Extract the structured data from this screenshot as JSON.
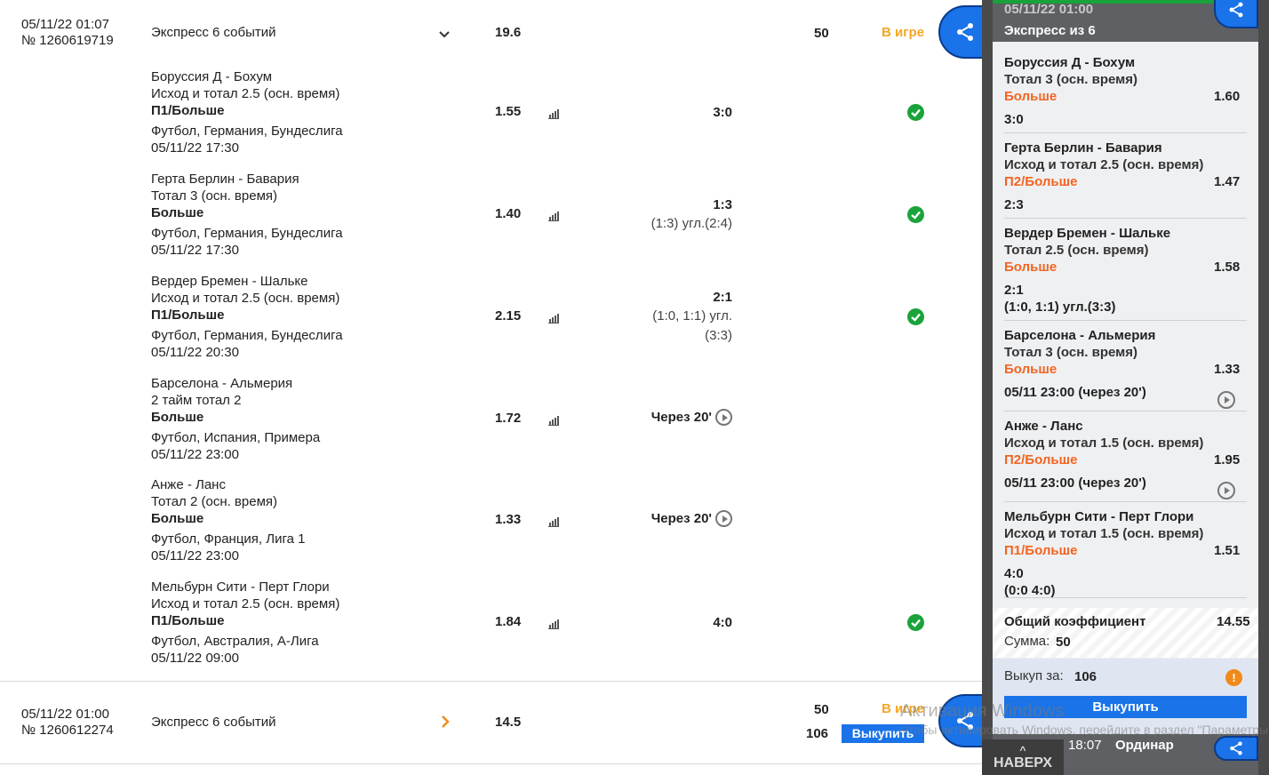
{
  "main": {
    "bet1": {
      "date": "05/11/22 01:07",
      "number": "№ 1260619719",
      "title": "Экспресс 6 событий",
      "odds": "19.6",
      "stake": "50",
      "status": "В игре",
      "events": [
        {
          "match": "Боруссия Д - Бохум",
          "market": "Исход и тотал 2.5 (осн. время)",
          "pick": "П1/Больше",
          "league": "Футбол, Германия, Бундеслига",
          "time": "05/11/22 17:30",
          "odds": "1.55",
          "score": "3:0",
          "score_sub": [],
          "state": "won"
        },
        {
          "match": "Герта Берлин - Бавария",
          "market": "Тотал 3 (осн. время)",
          "pick": "Больше",
          "league": "Футбол, Германия, Бундеслига",
          "time": "05/11/22 17:30",
          "odds": "1.40",
          "score": "1:3",
          "score_sub": [
            "(1:3) угл.(2:4)"
          ],
          "state": "won"
        },
        {
          "match": "Вердер Бремен - Шальке",
          "market": "Исход и тотал 2.5 (осн. время)",
          "pick": "П1/Больше",
          "league": "Футбол, Германия, Бундеслига",
          "time": "05/11/22 20:30",
          "odds": "2.15",
          "score": "2:1",
          "score_sub": [
            "(1:0, 1:1) угл.",
            "(3:3)"
          ],
          "state": "won"
        },
        {
          "match": "Барселона - Альмерия",
          "market": "2 тайм тотал 2",
          "pick": "Больше",
          "league": "Футбол, Испания, Примера",
          "time": "05/11/22 23:00",
          "odds": "1.72",
          "score": "Через 20'",
          "score_sub": [],
          "state": "pending"
        },
        {
          "match": "Анже - Ланс",
          "market": "Тотал 2 (осн. время)",
          "pick": "Больше",
          "league": "Футбол, Франция, Лига 1",
          "time": "05/11/22 23:00",
          "odds": "1.33",
          "score": "Через 20'",
          "score_sub": [],
          "state": "pending"
        },
        {
          "match": "Мельбурн Сити - Перт Глори",
          "market": "Исход и тотал 2.5 (осн. время)",
          "pick": "П1/Больше",
          "league": "Футбол, Австралия, А-Лига",
          "time": "05/11/22 09:00",
          "odds": "1.84",
          "score": "4:0",
          "score_sub": [],
          "state": "won"
        }
      ]
    },
    "bet2": {
      "date": "05/11/22 01:00",
      "number": "№ 1260612274",
      "title": "Экспресс 6 событий",
      "odds": "14.5",
      "stake": "50",
      "buyout_amount": "106",
      "status": "В игре",
      "buyout_label": "Выкупить"
    }
  },
  "panel": {
    "head_date": "05/11/22 01:00",
    "head_title": "Экспресс из 6",
    "events": [
      {
        "match": "Боруссия Д - Бохум",
        "market": "Тотал 3 (осн. время)",
        "pick": "Больше",
        "odds": "1.60",
        "result": [
          "3:0"
        ],
        "pending": false
      },
      {
        "match": "Герта Берлин - Бавария",
        "market": "Исход и тотал 2.5 (осн. время)",
        "pick": "П2/Больше",
        "odds": "1.47",
        "result": [
          "2:3"
        ],
        "pending": false
      },
      {
        "match": "Вердер Бремен - Шальке",
        "market": "Тотал 2.5 (осн. время)",
        "pick": "Больше",
        "odds": "1.58",
        "result": [
          "2:1",
          "(1:0, 1:1) угл.(3:3)"
        ],
        "pending": false
      },
      {
        "match": "Барселона - Альмерия",
        "market": "Тотал 3 (осн. время)",
        "pick": "Больше",
        "odds": "1.33",
        "result": [
          "05/11 23:00 (через 20')"
        ],
        "pending": true
      },
      {
        "match": "Анже - Ланс",
        "market": "Исход и тотал 1.5 (осн. время)",
        "pick": "П2/Больше",
        "odds": "1.95",
        "result": [
          "05/11 23:00 (через 20')"
        ],
        "pending": true
      },
      {
        "match": "Мельбурн Сити - Перт Глори",
        "market": "Исход и тотал 1.5 (осн. время)",
        "pick": "П1/Больше",
        "odds": "1.51",
        "result": [
          "4:0",
          "(0:0 4:0)"
        ],
        "pending": false
      }
    ],
    "total_label": "Общий коэффициент",
    "total_value": "14.55",
    "sum_label": "Сумма:",
    "sum_value": "50",
    "buyout_label": "Выкуп за:",
    "buyout_value": "106",
    "info_icon": "!",
    "buyout_button": "Выкупить",
    "next_time": "18:07",
    "next_type": "Ординар"
  },
  "scroll_top": {
    "label": "НАВЕРХ",
    "chevron": "^"
  },
  "watermark": {
    "line1": "Активация Windows",
    "line2": "Чтобы активировать Windows, перейдите в раздел \"Параметры\"."
  },
  "colors": {
    "accent_blue": "#1a73e8",
    "status_orange": "#f5a623",
    "pick_orange": "#f16522",
    "won_green": "#1aa33a",
    "panel_green": "#19a23a"
  }
}
